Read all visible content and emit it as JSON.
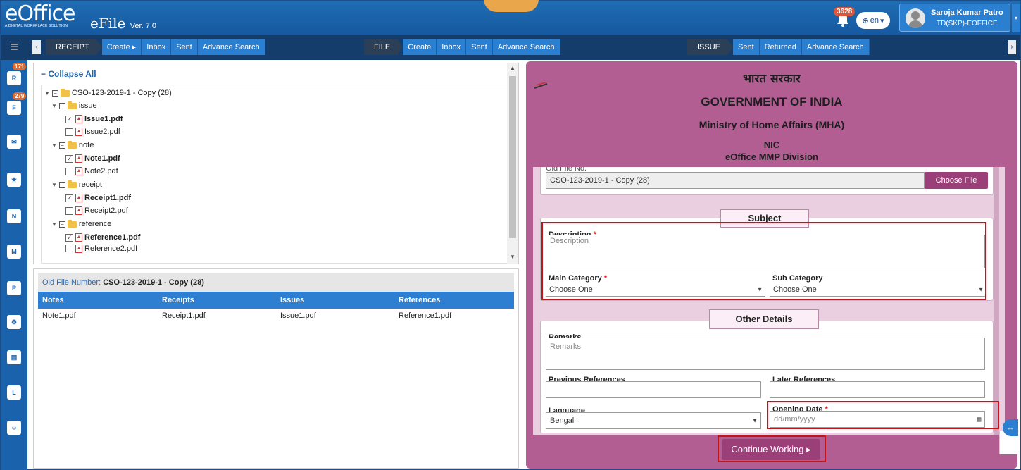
{
  "header": {
    "logo_text": "eOffice",
    "logo_tagline": "A DIGITAL WORKPLACE SOLUTION",
    "app_name": "eFile",
    "version": "Ver. 7.0",
    "notification_count": "3628",
    "language": "en",
    "user_name": "Saroja Kumar Patro",
    "user_role": "TD(SKP)-EOFFICE"
  },
  "nav": {
    "receipt": {
      "label": "RECEIPT",
      "items": [
        "Create ▸",
        "Inbox",
        "Sent",
        "Advance Search"
      ]
    },
    "file": {
      "label": "FILE",
      "items": [
        "Create",
        "Inbox",
        "Sent",
        "Advance Search"
      ]
    },
    "issue": {
      "label": "ISSUE",
      "items": [
        "Sent",
        "Returned",
        "Advance Search"
      ]
    }
  },
  "sidebar": {
    "badges": {
      "receipts": "171",
      "files": "279"
    },
    "icons": [
      "receipt-icon",
      "file-icon",
      "dak-icon",
      "vip-icon",
      "notice-icon",
      "manage-icon",
      "pp-icon",
      "settings-icon",
      "docs-icon",
      "log-icon",
      "admin-icon"
    ]
  },
  "tree": {
    "collapse_all": "Collapse All",
    "root": "CSO-123-2019-1 - Copy (28)",
    "folders": [
      {
        "name": "issue",
        "files": [
          {
            "name": "Issue1.pdf",
            "checked": true
          },
          {
            "name": "Issue2.pdf",
            "checked": false
          }
        ]
      },
      {
        "name": "note",
        "files": [
          {
            "name": "Note1.pdf",
            "checked": true
          },
          {
            "name": "Note2.pdf",
            "checked": false
          }
        ]
      },
      {
        "name": "receipt",
        "files": [
          {
            "name": "Receipt1.pdf",
            "checked": true
          },
          {
            "name": "Receipt2.pdf",
            "checked": false
          }
        ]
      },
      {
        "name": "reference",
        "files": [
          {
            "name": "Reference1.pdf",
            "checked": true
          },
          {
            "name": "Reference2.pdf",
            "checked": false
          }
        ]
      }
    ]
  },
  "file_table": {
    "old_file_label": "Old File Number:",
    "old_file_value": "CSO-123-2019-1 - Copy (28)",
    "headers": [
      "Notes",
      "Receipts",
      "Issues",
      "References"
    ],
    "rows": [
      [
        "Note1.pdf",
        "Receipt1.pdf",
        "Issue1.pdf",
        "Reference1.pdf"
      ]
    ]
  },
  "form": {
    "gov_hindi": "भारत सरकार",
    "gov_title": "GOVERNMENT OF INDIA",
    "ministry": "Ministry of Home Affairs (MHA)",
    "org": "NIC",
    "division": "eOffice MMP Division",
    "old_file_no_label": "Old File No.",
    "old_file_no_value": "CSO-123-2019-1 - Copy (28)",
    "choose_file": "Choose File",
    "subject_title": "Subject",
    "description_label": "Description",
    "description_placeholder": "Description",
    "main_category_label": "Main Category",
    "main_category_value": "Choose One",
    "sub_category_label": "Sub Category",
    "sub_category_value": "Choose One",
    "other_details_title": "Other Details",
    "remarks_label": "Remarks",
    "remarks_placeholder": "Remarks",
    "previous_references_label": "Previous References",
    "later_references_label": "Later References",
    "language_label": "Language",
    "language_value": "Bengali",
    "opening_date_label": "Opening Date",
    "opening_date_placeholder": "dd/mm/yyyy",
    "continue_button": "Continue Working ▸"
  },
  "colors": {
    "header_blue": "#1f6db3",
    "nav_dark": "#153d6b",
    "form_bg": "#b25e93",
    "button_purple": "#9b3f78",
    "highlight_red": "#c0151a"
  }
}
